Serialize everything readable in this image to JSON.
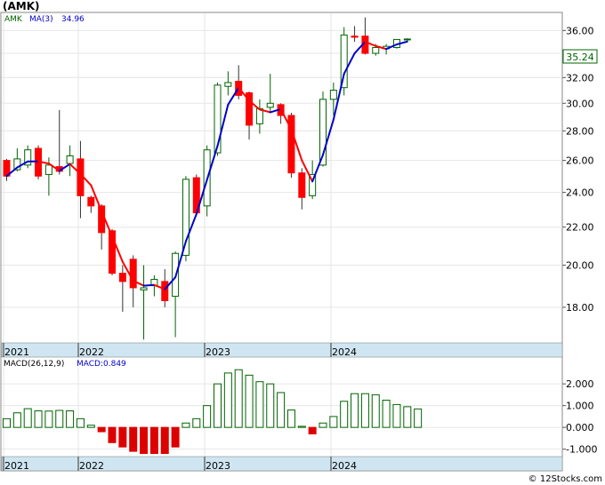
{
  "header": {
    "ticker": "(AMK)",
    "legend_ticker": "AMK",
    "ma_label": "MA(3)",
    "ma_value": "34.96",
    "macd_label": "MACD(26,12,9)",
    "macd_value_label": "MACD:0.849",
    "last_price": "35.24",
    "watermark": "© 12Stocks.com"
  },
  "colors": {
    "up_candle": "#ffffff",
    "up_outline": "#006400",
    "down_candle": "#ff0000",
    "ma_up": "#0000cc",
    "ma_down": "#ff0000",
    "macd_outline": "#006400",
    "macd_negative": "#dd0000",
    "axis_strip": "#cfe6f2",
    "grid": "#e6e6e6"
  },
  "chart_data": [
    {
      "type": "candlestick",
      "title": "(AMK)",
      "x_ticks": [
        "2021",
        "2022",
        "2023",
        "2024"
      ],
      "y_ticks": [
        "18.00",
        "20.00",
        "22.00",
        "24.00",
        "26.00",
        "28.00",
        "30.00",
        "32.00",
        "34.00",
        "36.00"
      ],
      "y_scale": "log",
      "ylim": [
        16.5,
        37.5
      ],
      "grid": true,
      "last_price": 35.24,
      "candles": [
        {
          "o": 26.0,
          "h": 26.1,
          "l": 24.7,
          "c": 25.0
        },
        {
          "o": 25.4,
          "h": 26.8,
          "l": 25.3,
          "c": 26.1
        },
        {
          "o": 25.7,
          "h": 27.0,
          "l": 25.5,
          "c": 26.7
        },
        {
          "o": 26.8,
          "h": 27.0,
          "l": 24.8,
          "c": 25.0
        },
        {
          "o": 25.1,
          "h": 26.2,
          "l": 23.8,
          "c": 25.7
        },
        {
          "o": 25.6,
          "h": 29.5,
          "l": 25.1,
          "c": 25.3
        },
        {
          "o": 25.8,
          "h": 27.0,
          "l": 25.0,
          "c": 26.3
        },
        {
          "o": 26.1,
          "h": 27.3,
          "l": 22.5,
          "c": 23.8
        },
        {
          "o": 23.7,
          "h": 23.8,
          "l": 22.8,
          "c": 23.2
        },
        {
          "o": 23.2,
          "h": 23.3,
          "l": 20.8,
          "c": 21.7
        },
        {
          "o": 21.8,
          "h": 21.9,
          "l": 19.5,
          "c": 19.6
        },
        {
          "o": 19.6,
          "h": 20.0,
          "l": 17.8,
          "c": 19.2
        },
        {
          "o": 20.3,
          "h": 20.5,
          "l": 18.0,
          "c": 18.9
        },
        {
          "o": 18.8,
          "h": 20.0,
          "l": 16.6,
          "c": 18.9
        },
        {
          "o": 19.0,
          "h": 19.5,
          "l": 18.5,
          "c": 19.3
        },
        {
          "o": 19.2,
          "h": 19.8,
          "l": 18.0,
          "c": 18.3
        },
        {
          "o": 18.5,
          "h": 20.7,
          "l": 16.7,
          "c": 20.6
        },
        {
          "o": 20.5,
          "h": 25.0,
          "l": 20.2,
          "c": 24.8
        },
        {
          "o": 24.9,
          "h": 25.1,
          "l": 22.7,
          "c": 22.8
        },
        {
          "o": 23.2,
          "h": 27.0,
          "l": 22.6,
          "c": 26.7
        },
        {
          "o": 26.5,
          "h": 31.6,
          "l": 26.3,
          "c": 31.4
        },
        {
          "o": 31.3,
          "h": 32.5,
          "l": 30.6,
          "c": 31.6
        },
        {
          "o": 31.7,
          "h": 33.0,
          "l": 30.3,
          "c": 30.6
        },
        {
          "o": 30.8,
          "h": 30.9,
          "l": 27.4,
          "c": 28.4
        },
        {
          "o": 28.5,
          "h": 30.3,
          "l": 27.8,
          "c": 29.6
        },
        {
          "o": 29.7,
          "h": 32.3,
          "l": 29.4,
          "c": 30.0
        },
        {
          "o": 29.9,
          "h": 30.0,
          "l": 28.5,
          "c": 29.1
        },
        {
          "o": 29.1,
          "h": 29.3,
          "l": 24.9,
          "c": 25.2
        },
        {
          "o": 25.2,
          "h": 25.5,
          "l": 23.0,
          "c": 23.7
        },
        {
          "o": 23.8,
          "h": 26.0,
          "l": 23.6,
          "c": 25.1
        },
        {
          "o": 25.7,
          "h": 30.9,
          "l": 25.6,
          "c": 30.3
        },
        {
          "o": 30.3,
          "h": 31.6,
          "l": 29.1,
          "c": 31.0
        },
        {
          "o": 31.2,
          "h": 36.3,
          "l": 30.6,
          "c": 35.6
        },
        {
          "o": 35.5,
          "h": 36.4,
          "l": 35.0,
          "c": 35.4
        },
        {
          "o": 35.5,
          "h": 37.2,
          "l": 33.9,
          "c": 34.0
        },
        {
          "o": 34.0,
          "h": 34.8,
          "l": 33.8,
          "c": 34.5
        },
        {
          "o": 34.4,
          "h": 34.8,
          "l": 33.9,
          "c": 34.6
        },
        {
          "o": 34.5,
          "h": 35.2,
          "l": 34.4,
          "c": 35.2
        },
        {
          "o": 35.2,
          "h": 35.3,
          "l": 35.0,
          "c": 35.24
        }
      ]
    },
    {
      "type": "bar",
      "title": "MACD(26,12,9)",
      "x_ticks": [
        "2021",
        "2022",
        "2023",
        "2024"
      ],
      "y_ticks": [
        "-1.000",
        "0.000",
        "1.000",
        "2.000"
      ],
      "ylim": [
        -1.3,
        2.7
      ],
      "values": [
        0.4,
        0.67,
        0.86,
        0.76,
        0.75,
        0.78,
        0.76,
        0.4,
        0.1,
        -0.2,
        -0.7,
        -0.9,
        -1.1,
        -1.2,
        -1.2,
        -1.2,
        -0.9,
        0.2,
        0.4,
        1.0,
        2.0,
        2.5,
        2.65,
        2.4,
        2.1,
        2.0,
        1.6,
        0.8,
        0.05,
        -0.3,
        0.2,
        0.5,
        1.2,
        1.55,
        1.55,
        1.5,
        1.25,
        1.05,
        0.95,
        0.849
      ]
    }
  ]
}
